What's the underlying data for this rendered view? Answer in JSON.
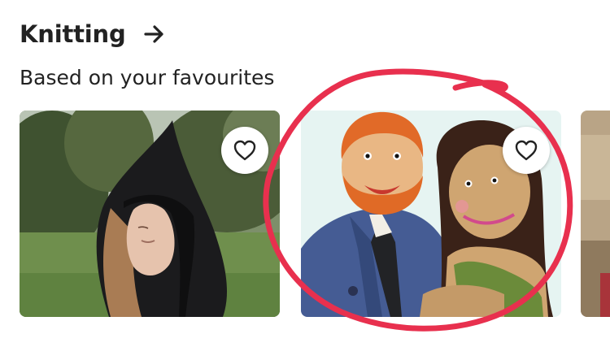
{
  "section": {
    "title": "Knitting",
    "subtitle": "Based on your favourites"
  },
  "icons": {
    "see_more": "arrow-right-icon",
    "favourite": "heart-outline-icon"
  },
  "listings": [
    {
      "description": "black knitted pointed hood worn by a woman outdoors",
      "favourited": false
    },
    {
      "description": "knitted dolls of a red-bearded man in a blue jacket and a dark-haired woman",
      "favourited": false
    },
    {
      "description": "partially visible listing",
      "favourited": false
    }
  ],
  "annotation": {
    "shape": "hand-drawn circle",
    "color": "#E8304E"
  }
}
